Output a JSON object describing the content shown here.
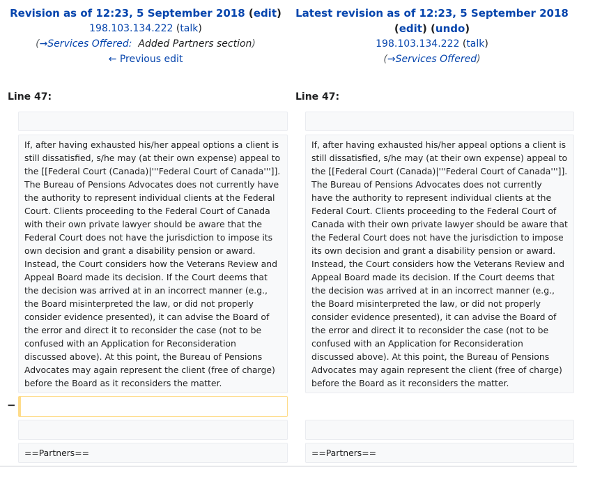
{
  "left": {
    "title_prefix": "Revision as of 12:23, 5 September 2018",
    "edit_label": "edit",
    "user": "198.103.134.222",
    "talk_label": "talk",
    "summary_section": "→Services Offered:",
    "summary_text": "Added Partners section",
    "prev_edit_label": "← Previous edit"
  },
  "right": {
    "title": "Latest revision as of 12:23, 5 September 2018",
    "edit_label": "edit",
    "undo_label": "undo",
    "user": "198.103.134.222",
    "talk_label": "talk",
    "summary_section": "→Services Offered"
  },
  "line_label_left": "Line 47:",
  "line_label_right": "Line 47:",
  "removed_marker": "−",
  "paragraph_left_lines": [
    "If, after having exhausted his/her appeal options a client is",
    "still dissatisfied, s/he may (at their own expense) appeal to",
    "the [[Federal Court (Canada)|'''Federal Court of Canada''']].",
    "The Bureau of Pensions Advocates does not currently have",
    "the authority to represent individual clients at the Federal",
    "Court. Clients proceeding to the Federal Court of Canada",
    "with their own private lawyer should be aware that the",
    "Federal Court does not have the jurisdiction to impose its",
    "own decision and grant a disability pension or award.",
    "Instead, the Court considers how the Veterans Review and",
    "Appeal Board made its decision. If the Court deems that",
    "the decision was arrived at in an incorrect manner (e.g.,",
    "the Board misinterpreted the law, or did not properly",
    "consider evidence presented), it can advise the Board of",
    "the error and direct it to reconsider the case (not to be",
    "confused with an Application for Reconsideration",
    "discussed above). At this point, the Bureau of Pensions",
    "Advocates may again represent the client (free of charge)",
    "before the Board as it reconsiders the matter."
  ],
  "paragraph_right_lines": [
    "If, after having exhausted his/her appeal options a client is",
    "still dissatisfied, s/he may (at their own expense) appeal to",
    "the [[Federal Court (Canada)|'''Federal Court of Canada''']].",
    "The Bureau of Pensions Advocates does not currently",
    "have the authority to represent individual clients at the",
    "Federal Court. Clients proceeding to the Federal Court of",
    "Canada with their own private lawyer should be aware that",
    "the Federal Court does not have the jurisdiction to impose",
    "its own decision and grant a disability pension or award.",
    "Instead, the Court considers how the Veterans Review and",
    "Appeal Board made its decision. If the Court deems that",
    "the decision was arrived at in an incorrect manner (e.g.,",
    "the Board misinterpreted the law, or did not properly",
    "consider evidence presented), it can advise the Board of",
    "the error and direct it to reconsider the case (not to be",
    "confused with an Application for Reconsideration",
    "discussed above). At this point, the Bureau of Pensions",
    "Advocates may again represent the client (free of charge)",
    "before the Board as it reconsiders the matter."
  ],
  "partners_left": "==Partners==",
  "partners_right": "==Partners=="
}
